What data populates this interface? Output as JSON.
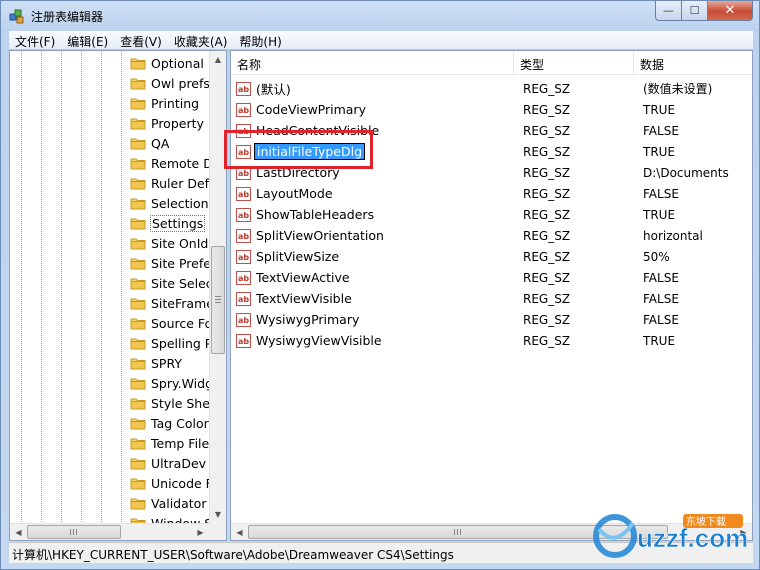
{
  "window": {
    "title": "注册表编辑器"
  },
  "menu": [
    "文件(F)",
    "编辑(E)",
    "查看(V)",
    "收藏夹(A)",
    "帮助(H)"
  ],
  "tree": {
    "items": [
      "Optional D",
      "Owl prefs",
      "Printing",
      "Property I",
      "QA",
      "Remote D",
      "Ruler Defa",
      "Selection",
      "Settings",
      "Site OnIdl",
      "Site Prefe",
      "Site Select",
      "SiteFrame",
      "Source Fo",
      "Spelling P",
      "SPRY",
      "Spry.Widg",
      "Style Shee",
      "Tag Color",
      "Temp File",
      "UltraDev F",
      "Unicode F",
      "Validator",
      "Window S"
    ],
    "selected": "Settings",
    "scroll_arrows": {
      "up": "▲",
      "down": "▼",
      "left": "◀",
      "right": "▶"
    }
  },
  "list": {
    "columns": {
      "name": "名称",
      "type": "类型",
      "data": "数据"
    },
    "rows": [
      {
        "name": "(默认)",
        "type": "REG_SZ",
        "data": "(数值未设置)"
      },
      {
        "name": "CodeViewPrimary",
        "type": "REG_SZ",
        "data": "TRUE"
      },
      {
        "name": "HeadContentVisible",
        "type": "REG_SZ",
        "data": "FALSE"
      },
      {
        "name": "initialFileTypeDlg",
        "type": "REG_SZ",
        "data": "TRUE"
      },
      {
        "name": "LastDirectory",
        "type": "REG_SZ",
        "data": "D:\\Documents"
      },
      {
        "name": "LayoutMode",
        "type": "REG_SZ",
        "data": "FALSE"
      },
      {
        "name": "ShowTableHeaders",
        "type": "REG_SZ",
        "data": "TRUE"
      },
      {
        "name": "SplitViewOrientation",
        "type": "REG_SZ",
        "data": "horizontal"
      },
      {
        "name": "SplitViewSize",
        "type": "REG_SZ",
        "data": "50%"
      },
      {
        "name": "TextViewActive",
        "type": "REG_SZ",
        "data": "FALSE"
      },
      {
        "name": "TextViewVisible",
        "type": "REG_SZ",
        "data": "FALSE"
      },
      {
        "name": "WysiwygPrimary",
        "type": "REG_SZ",
        "data": "FALSE"
      },
      {
        "name": "WysiwygViewVisible",
        "type": "REG_SZ",
        "data": "TRUE"
      }
    ],
    "editing_row": 3,
    "icon": "reg-string-icon"
  },
  "status": {
    "path": "计算机\\HKEY_CURRENT_USER\\Software\\Adobe\\Dreamweaver CS4\\Settings"
  },
  "watermark": {
    "text": "uzzf.com",
    "tag": "东坡下载"
  },
  "colors": {
    "highlight": "#3399ff",
    "annotation": "#e0232b",
    "folder": "#f1c54e"
  }
}
